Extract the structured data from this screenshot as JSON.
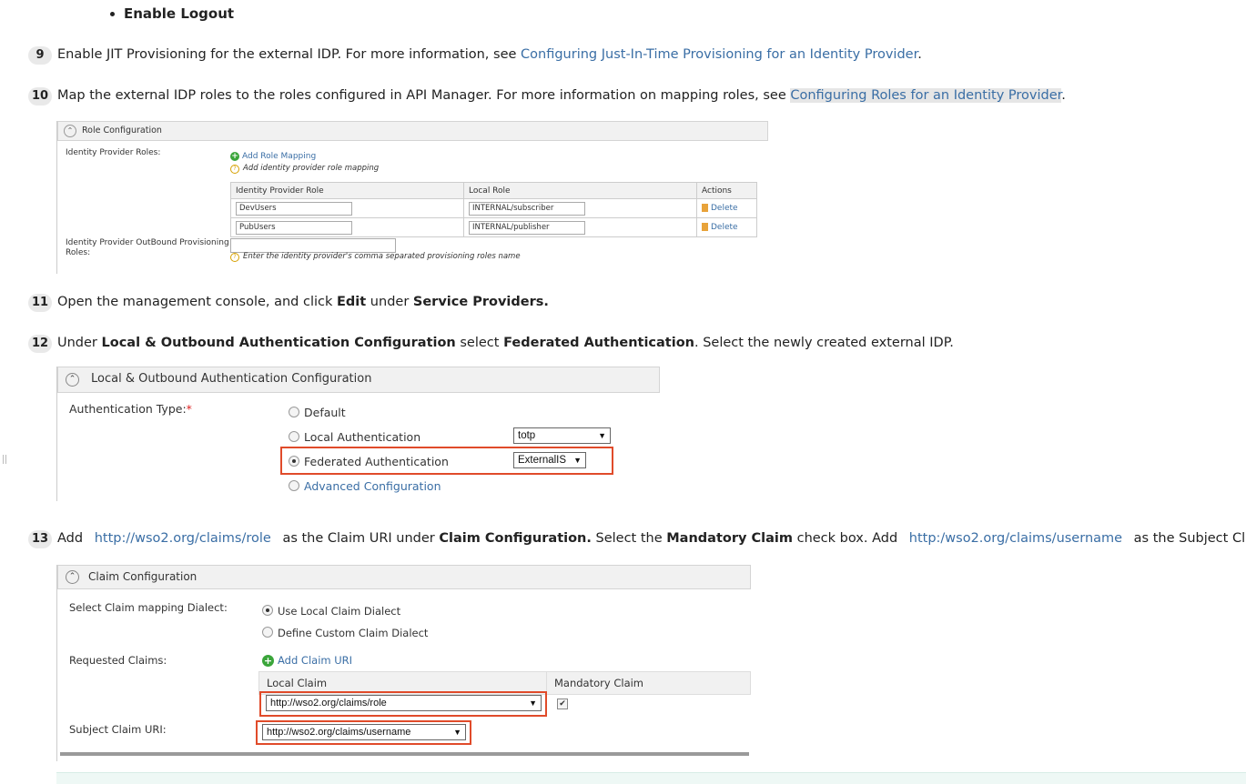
{
  "bullet": "Enable Logout",
  "steps": {
    "s9": {
      "num": "9",
      "text": "Enable JIT Provisioning for the external IDP. For more information, see ",
      "link": "Configuring Just-In-Time Provisioning for an Identity Provider",
      "end": "."
    },
    "s10": {
      "num": "10",
      "text": "Map the external IDP roles to the roles configured in API Manager. For more information on mapping roles, see ",
      "link": "Configuring Roles for an Identity Provider",
      "end": "."
    },
    "s11": {
      "num": "11",
      "t1": "Open the management console, and click ",
      "b1": "Edit",
      "t2": " under ",
      "b2": "Service Providers."
    },
    "s12": {
      "num": "12",
      "t1": "Under ",
      "b1": "Local & Outbound Authentication Configuration",
      "t2": " select ",
      "b2": "Federated Authentication",
      "t3": ". Select the newly created external IDP."
    },
    "s13": {
      "num": "13",
      "t1": "Add ",
      "link1": "http://wso2.org/claims/role",
      "t2": " as the Claim URI under ",
      "b1": "Claim Configuration.",
      "t3": " Select the ",
      "b2": "Mandatory Claim",
      "t4": " check box. Add ",
      "link2": "http:/wso2.org/claims/username",
      "t5": " as the Subject Claim U"
    }
  },
  "role_config": {
    "title": "Role Configuration",
    "idp_roles_label": "Identity Provider Roles:",
    "add_role_mapping": "Add Role Mapping",
    "add_hint": "Add identity provider role mapping",
    "columns": [
      "Identity Provider Role",
      "Local Role",
      "Actions"
    ],
    "rows": [
      {
        "idp": "DevUsers",
        "local": "INTERNAL/subscriber",
        "action": "Delete"
      },
      {
        "idp": "PubUsers",
        "local": "INTERNAL/publisher",
        "action": "Delete"
      }
    ],
    "outbound_label_1": "Identity Provider OutBound Provisioning",
    "outbound_label_2": "Roles:",
    "outbound_hint": "Enter the identity provider's comma separated provisioning roles name"
  },
  "auth_config": {
    "title": "Local & Outbound Authentication Configuration",
    "type_label": "Authentication Type:",
    "required_mark": "*",
    "options": {
      "default": "Default",
      "local": "Local Authentication",
      "federated": "Federated Authentication",
      "advanced": "Advanced Configuration"
    },
    "local_select": "totp",
    "federated_select": "ExternalIS",
    "selected": "federated"
  },
  "claim_config": {
    "title": "Claim Configuration",
    "dialect_label": "Select Claim mapping Dialect:",
    "use_local": "Use Local Claim Dialect",
    "define_custom": "Define Custom Claim Dialect",
    "requested_label": "Requested Claims:",
    "add_claim_uri": "Add Claim URI",
    "col_local": "Local Claim",
    "col_mandatory": "Mandatory Claim",
    "claim_value": "http://wso2.org/claims/role",
    "mandatory_checked": "✔",
    "subject_label": "Subject Claim URI:",
    "subject_value": "http://wso2.org/claims/username"
  },
  "icons": {
    "collapse": "⌃",
    "dropdown": "▼",
    "add": "+",
    "help": "?"
  },
  "colors": {
    "link": "#3a6ea5",
    "highlight_box": "#e04b2a",
    "add_icon": "#3aa53a"
  }
}
